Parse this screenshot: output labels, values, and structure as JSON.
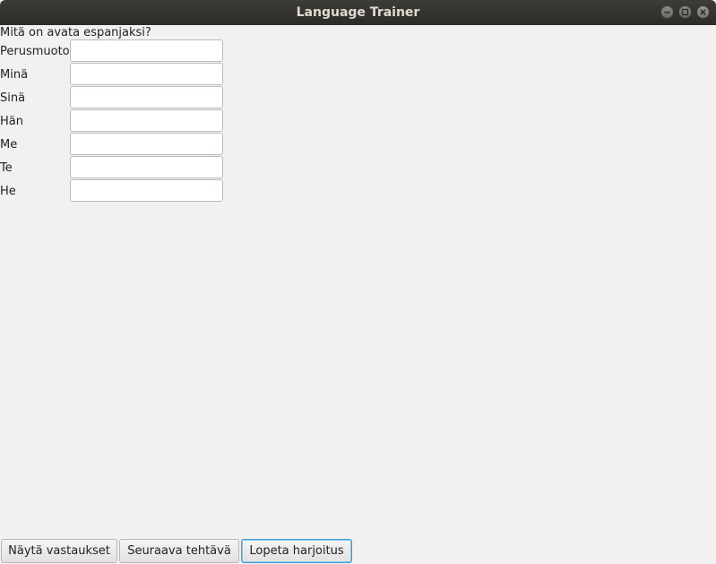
{
  "window": {
    "title": "Language Trainer"
  },
  "exercise": {
    "question": "Mitä on avata espanjaksi?",
    "rows": [
      {
        "label": "Perusmuoto",
        "value": ""
      },
      {
        "label": "Minä",
        "value": ""
      },
      {
        "label": "Sinä",
        "value": ""
      },
      {
        "label": "Hän",
        "value": ""
      },
      {
        "label": "Me",
        "value": ""
      },
      {
        "label": "Te",
        "value": ""
      },
      {
        "label": "He",
        "value": ""
      }
    ]
  },
  "buttons": {
    "show_answers": "Näytä vastaukset",
    "next_task": "Seuraava tehtävä",
    "end_exercise": "Lopeta harjoitus"
  },
  "icons": {
    "minimize": "minimize-icon",
    "maximize": "maximize-icon",
    "close": "close-icon"
  }
}
